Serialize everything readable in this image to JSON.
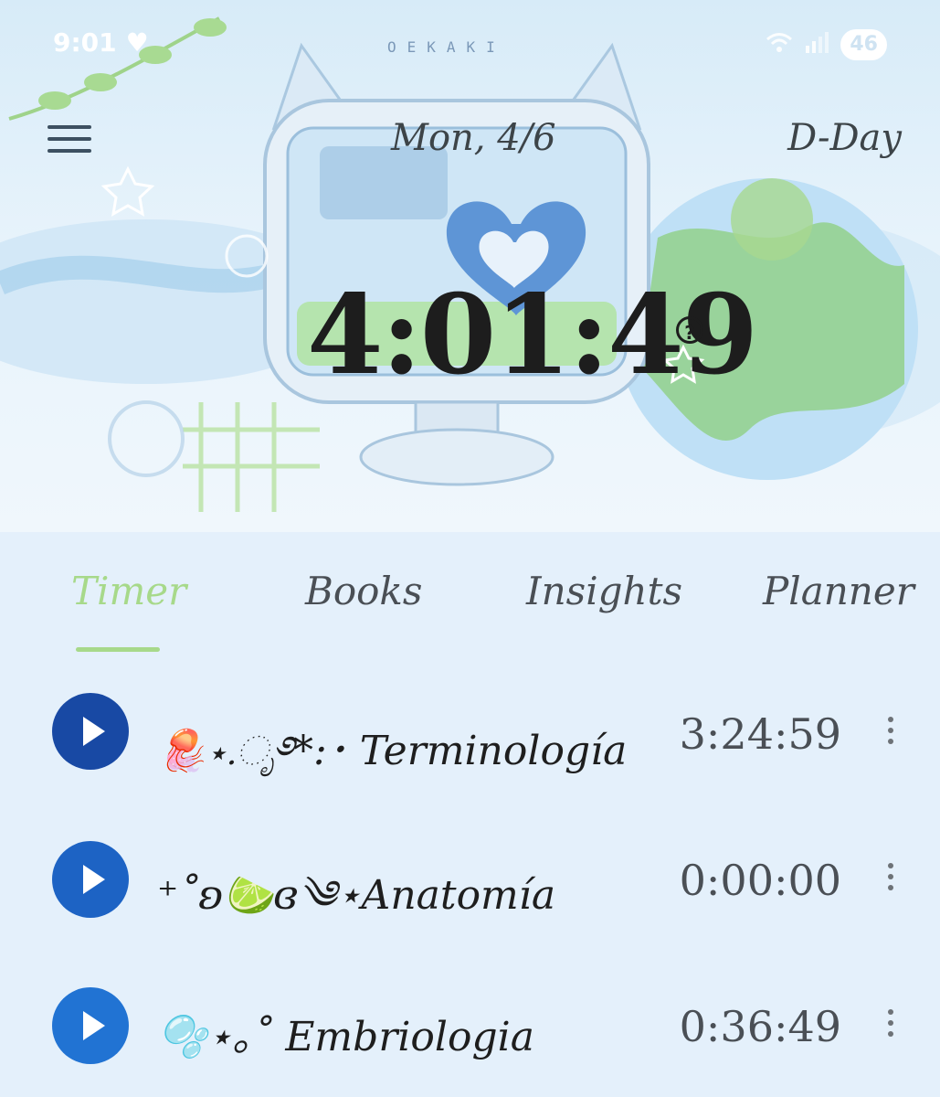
{
  "status_bar": {
    "time": "9:01",
    "heart": "♥",
    "wifi": "wifi-icon",
    "signal": "signal-icon",
    "battery": "46"
  },
  "header": {
    "brand": "OEKAKI",
    "date": "Mon, 4/6",
    "dday_label": "D-Day",
    "total_time": "4:01:49",
    "help": "?"
  },
  "tabs": [
    {
      "label": "Timer",
      "active": true
    },
    {
      "label": "Books",
      "active": false
    },
    {
      "label": "Insights",
      "active": false
    },
    {
      "label": "Planner",
      "active": false
    }
  ],
  "subjects": [
    {
      "name": "🪼⋆.ೃ࿔*:･ Terminología",
      "time": "3:24:59",
      "color": "#1849a4"
    },
    {
      "name": "⁺˚ʚ🍋‍🟩ɞ༄⋆Anatomía",
      "time": "0:00:00",
      "color": "#1d63c4"
    },
    {
      "name": "🫧⋆｡˚ Embriologia",
      "time": "0:36:49",
      "color": "#2173d3"
    }
  ],
  "colors": {
    "accent": "#a7d98a",
    "text": "#3d4448"
  }
}
